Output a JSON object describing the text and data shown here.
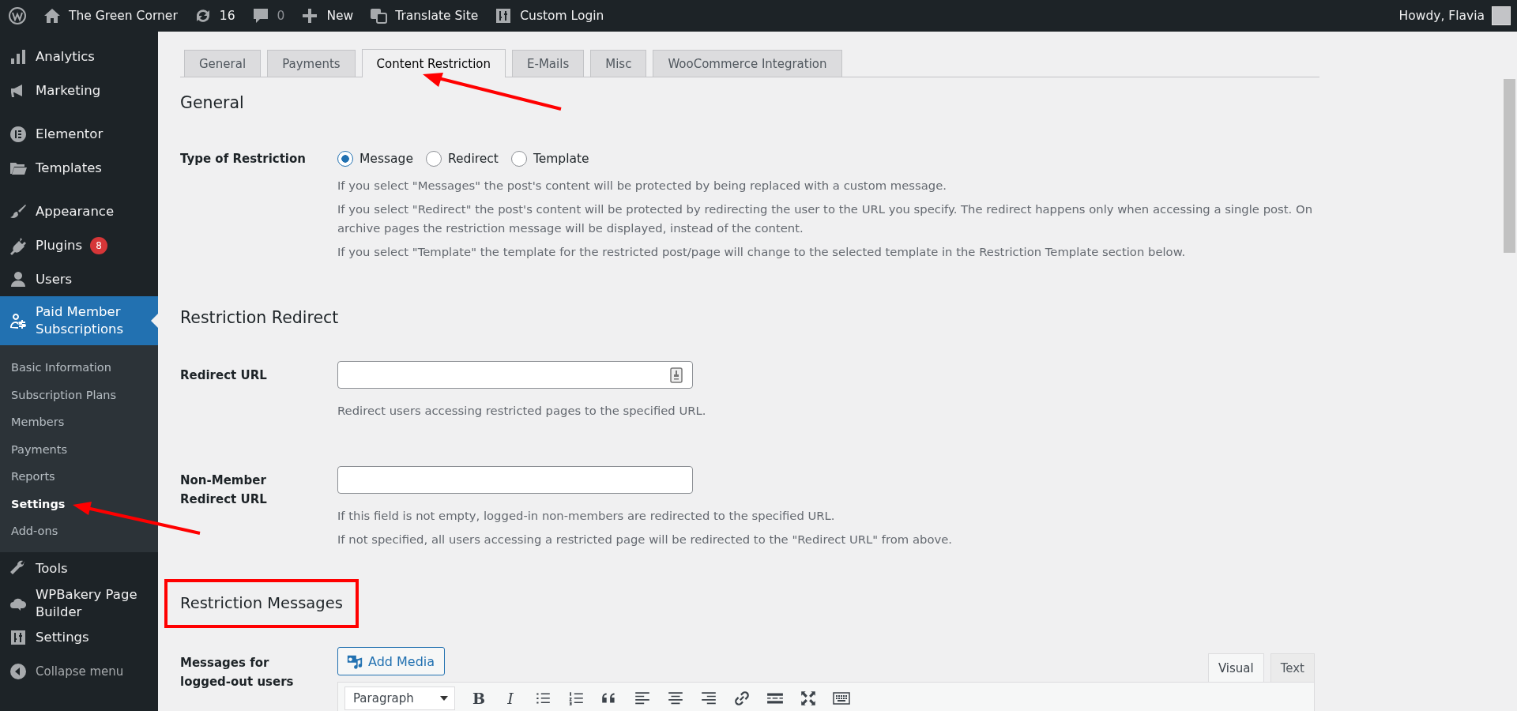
{
  "admin_bar": {
    "site_name": "The Green Corner",
    "updates_count": "16",
    "comments_count": "0",
    "new_label": "New",
    "translate_label": "Translate Site",
    "custom_login_label": "Custom Login",
    "greeting": "Howdy, Flavia"
  },
  "sidebar": {
    "groups": [
      [
        {
          "label": "Analytics",
          "selected": false
        },
        {
          "label": "Marketing",
          "selected": false
        }
      ],
      [
        {
          "label": "Elementor",
          "selected": false
        },
        {
          "label": "Templates",
          "selected": false
        }
      ],
      [
        {
          "label": "Appearance",
          "selected": false
        },
        {
          "label": "Plugins",
          "badge": "8",
          "selected": false
        },
        {
          "label": "Users",
          "selected": false
        },
        {
          "label": "Paid Member Subscriptions",
          "selected": true,
          "children": [
            {
              "label": "Basic Information",
              "selected": false
            },
            {
              "label": "Subscription Plans",
              "selected": false
            },
            {
              "label": "Members",
              "selected": false
            },
            {
              "label": "Payments",
              "selected": false
            },
            {
              "label": "Reports",
              "selected": false
            },
            {
              "label": "Settings",
              "selected": true
            },
            {
              "label": "Add-ons",
              "selected": false
            }
          ]
        },
        {
          "label": "Tools",
          "selected": false
        },
        {
          "label": "WPBakery Page Builder",
          "selected": false
        },
        {
          "label": "Settings",
          "selected": false
        }
      ]
    ],
    "collapse_label": "Collapse menu"
  },
  "tabs": [
    {
      "label": "General",
      "selected": false
    },
    {
      "label": "Payments",
      "selected": false
    },
    {
      "label": "Content Restriction",
      "selected": true
    },
    {
      "label": "E-Mails",
      "selected": false
    },
    {
      "label": "Misc",
      "selected": false
    },
    {
      "label": "WooCommerce Integration",
      "selected": false
    }
  ],
  "general": {
    "heading": "General",
    "type_label": "Type of Restriction",
    "options": [
      {
        "label": "Message",
        "selected": true
      },
      {
        "label": "Redirect",
        "selected": false
      },
      {
        "label": "Template",
        "selected": false
      }
    ],
    "descriptions": [
      "If you select \"Messages\" the post's content will be protected by being replaced with a custom message.",
      "If you select \"Redirect\" the post's content will be protected by redirecting the user to the URL you specify. The redirect happens only when accessing a single post. On archive pages the restriction message will be displayed, instead of the content.",
      "If you select \"Template\" the template for the restricted post/page will change to the selected template in the Restriction Template section below."
    ]
  },
  "redirect": {
    "heading": "Restriction Redirect",
    "fields": [
      {
        "label": "Redirect URL",
        "descriptions": [
          "Redirect users accessing restricted pages to the specified URL."
        ]
      },
      {
        "label": "Non-Member Redirect URL",
        "descriptions": [
          "If this field is not empty, logged-in non-members are redirected to the specified URL.",
          "If not specified, all users accessing a restricted page will be redirected to the \"Redirect URL\" from above."
        ]
      }
    ]
  },
  "messages": {
    "heading": "Restriction Messages",
    "label": "Messages for logged-out users",
    "add_media": "Add Media",
    "editor_tabs": [
      {
        "label": "Visual",
        "selected": true
      },
      {
        "label": "Text",
        "selected": false
      }
    ],
    "format_select": "Paragraph",
    "bold_label": "B",
    "italic_label": "I"
  }
}
